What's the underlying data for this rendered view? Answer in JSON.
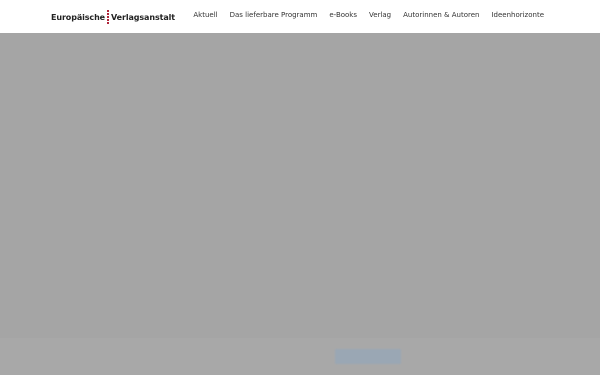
{
  "header": {
    "logo_left": "Europäische",
    "logo_right": "Verlagsanstalt",
    "nav": [
      {
        "label": "Aktuell"
      },
      {
        "label": "Das lieferbare Programm"
      },
      {
        "label": "e-Books"
      },
      {
        "label": "Verlag"
      },
      {
        "label": "Autorinnen & Autoren"
      },
      {
        "label": "Ideenhorizonte"
      }
    ]
  },
  "colors": {
    "overlay": "#a5a5a5",
    "header_bg": "#ffffff",
    "logo_accent": "#b0253a"
  }
}
